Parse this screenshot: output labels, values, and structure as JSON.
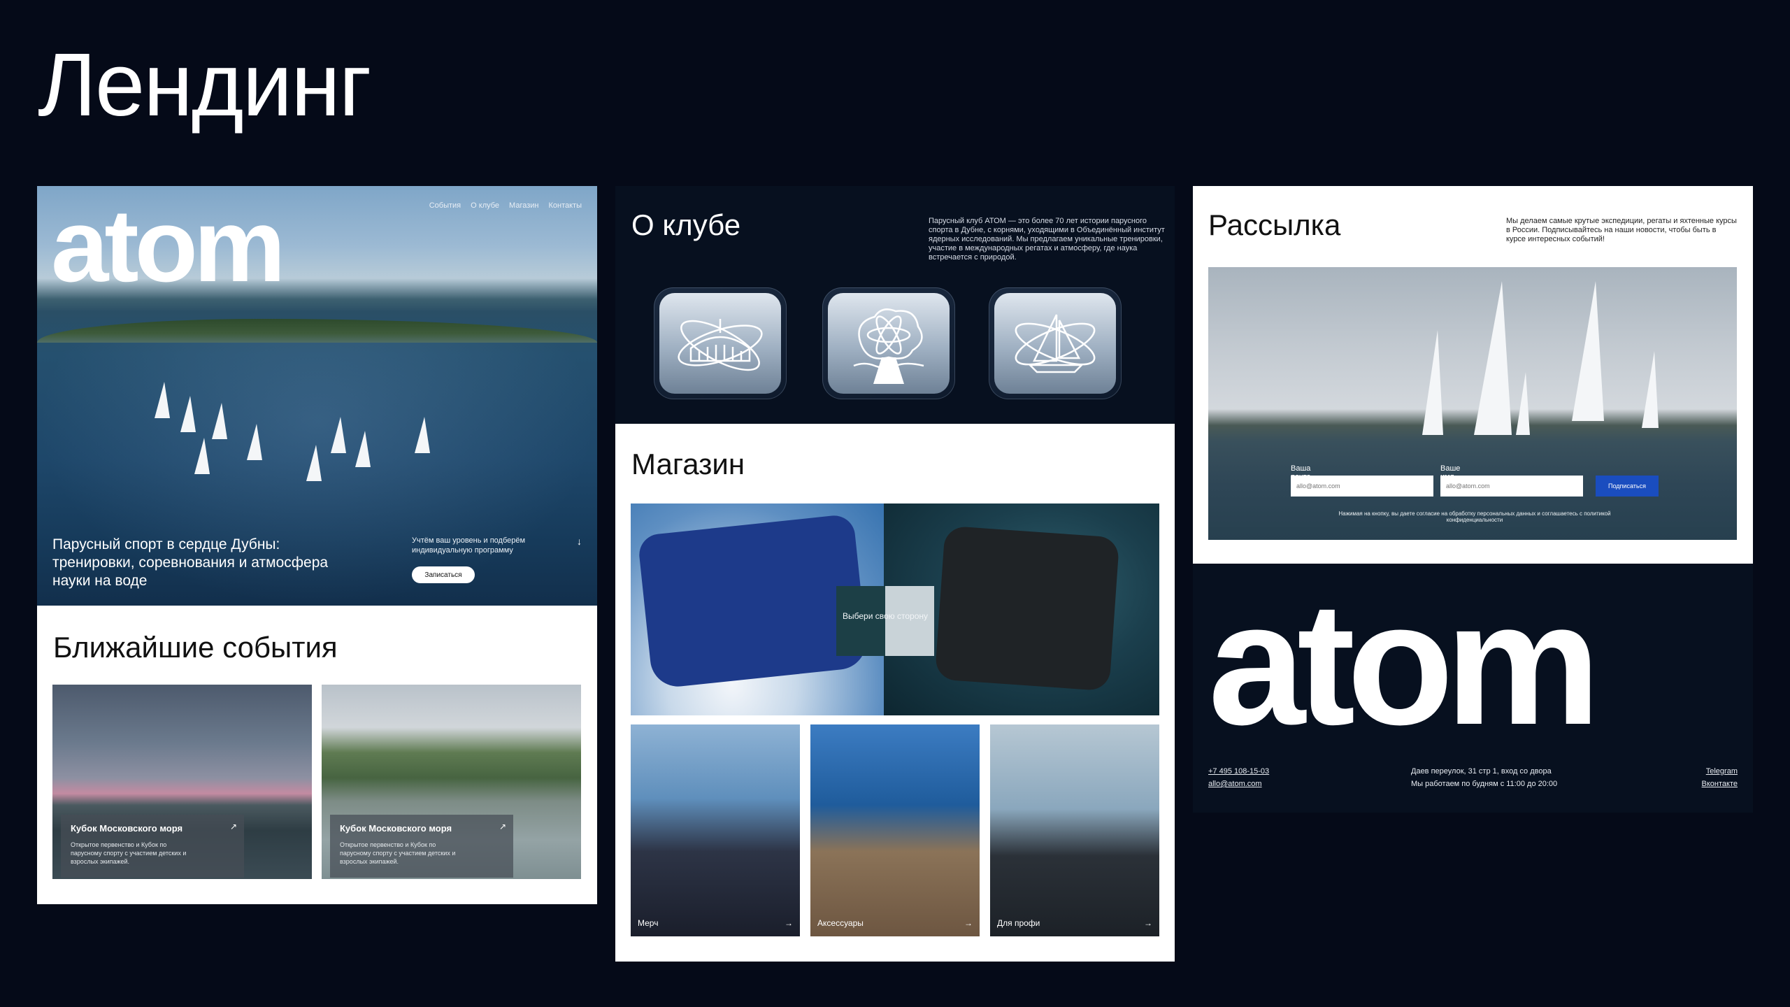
{
  "page": {
    "title": "Лендинг"
  },
  "hero": {
    "logo": "atom",
    "nav": [
      "События",
      "О клубе",
      "Магазин",
      "Контакты"
    ],
    "headline": "Парусный спорт в сердце Дубны: тренировки, соревнования и атмосфера науки на воде",
    "subtext": "Учтём ваш уровень и подберём индивидуальную программу",
    "cta": "Записаться",
    "arrow": "↓"
  },
  "events": {
    "title": "Ближайшие события",
    "cards": [
      {
        "title": "Кубок Московского моря",
        "description": "Открытое первенство и Кубок по парусному спорту с участием детских и взрослых экипажей.",
        "arrow": "↗"
      },
      {
        "title": "Кубок Московского моря",
        "description": "Открытое первенство и Кубок по парусному спорту с участием детских и взрослых экипажей.",
        "arrow": "↗"
      }
    ]
  },
  "about": {
    "title": "О клубе",
    "text": "Парусный клуб АТОМ — это более 70 лет истории парусного спорта в Дубне, с корнями, уходящими в Объединённый институт ядерных исследований. Мы предлагаем уникальные тренировки, участие в международных регатах и атмосферу, где наука встречается с природой.",
    "icons": [
      "atom-building-icon",
      "atom-tree-icon",
      "atom-sailboat-icon"
    ]
  },
  "shop": {
    "title": "Магазин",
    "center_label": "Выбери свою сторону",
    "categories": [
      {
        "label": "Мерч",
        "arrow": "→"
      },
      {
        "label": "Аксессуары",
        "arrow": "→"
      },
      {
        "label": "Для профи",
        "arrow": "→"
      }
    ]
  },
  "newsletter": {
    "title": "Рассылка",
    "text": "Мы делаем самые крутые экспедиции, регаты и яхтенные курсы в России. Подписывайтесь на наши новости, чтобы быть в курсе интересных событий!",
    "email_label": "Ваша почта",
    "email_placeholder": "allo@atom.com",
    "name_label": "Ваше имя",
    "name_placeholder": "allo@atom.com",
    "submit": "Подписаться",
    "consent": "Нажимая на кнопку, вы даете согласие на обработку персональных данных и соглашаетесь с политикой конфиденциальности"
  },
  "footer": {
    "logo": "atom",
    "phone": "+7 495 108-15-03",
    "email": "allo@atom.com",
    "address": "Даев переулок, 31 стр 1, вход со двора",
    "hours": "Мы работаем по будням с 11:00 до 20:00",
    "link1": "Telegram",
    "link2": "Вконтакте"
  },
  "colors": {
    "background": "#050a18",
    "panel_dark": "#07101f",
    "accent_blue": "#1a4dbf"
  }
}
